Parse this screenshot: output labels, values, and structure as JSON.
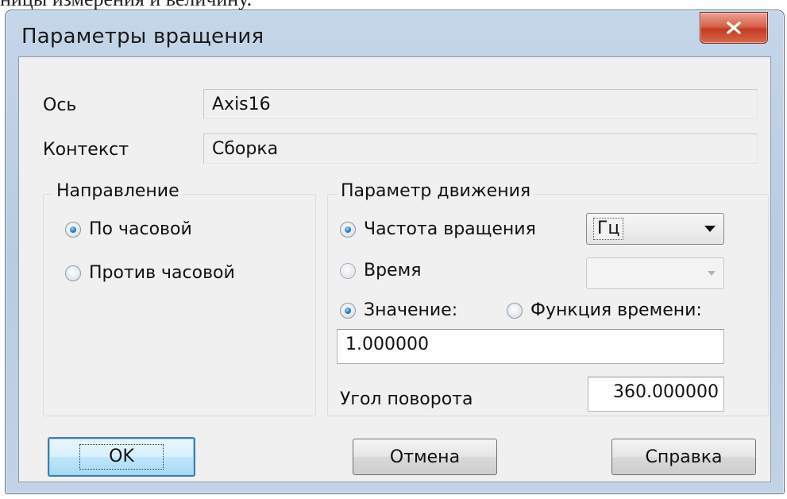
{
  "top_caption": "ницы измерения и величину.",
  "window": {
    "title": "Параметры вращения",
    "close_glyph": "✕"
  },
  "fields": {
    "axis_label": "Ось",
    "axis_value": "Axis16",
    "context_label": "Контекст",
    "context_value": "Сборка"
  },
  "direction": {
    "legend": "Направление",
    "options": [
      {
        "label": "По часовой",
        "checked": true
      },
      {
        "label": "Против часовой",
        "checked": false
      }
    ]
  },
  "motion": {
    "legend": "Параметр движения",
    "frequency_label": "Частота вращения",
    "frequency_checked": true,
    "frequency_unit": "Гц",
    "time_label": "Время",
    "time_checked": false,
    "time_unit": "",
    "value_label": "Значение:",
    "value_checked": true,
    "time_function_label": "Функция времени:",
    "time_function_checked": false,
    "value": "1.000000",
    "angle_label": "Угол поворота",
    "angle_value": "360.000000"
  },
  "buttons": {
    "ok": "OK",
    "cancel": "Отмена",
    "help": "Справка"
  },
  "colors": {
    "close_button": "#d9624a",
    "default_button_border": "#3c7fb1",
    "radio_selected": "#1f74c8"
  }
}
